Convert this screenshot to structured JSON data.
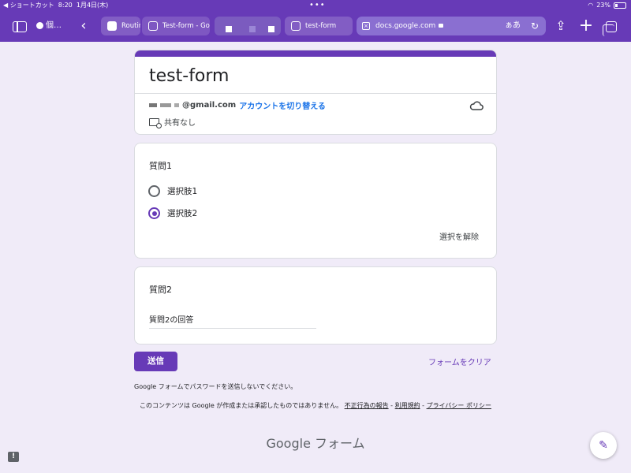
{
  "status_bar": {
    "shortcut": "◀ ショートカット",
    "time": "8:20",
    "date": "1月4日(木)",
    "battery": "23%"
  },
  "browser": {
    "profile_label": "個…",
    "tabs": [
      {
        "label": "Routine",
        "active": false
      },
      {
        "label": "Test-form - Go",
        "active": true
      },
      {
        "label": "test-form",
        "active": false
      }
    ],
    "address": "docs.google.com",
    "kana_label": "ぁあ"
  },
  "form": {
    "title": "test-form",
    "account_email": "@gmail.com",
    "switch_account_label": "アカウントを切り替える",
    "share_status": "共有なし",
    "questions": [
      {
        "title": "質問1",
        "options": [
          "選択肢1",
          "選択肢2"
        ],
        "selected": "選択肢2",
        "clear_label": "選択を解除"
      },
      {
        "title": "質問2",
        "answer": "質問2の回答"
      }
    ],
    "submit_label": "送信",
    "clear_form_label": "フォームをクリア"
  },
  "footer": {
    "password_warning": "Google フォームでパスワードを送信しないでください。",
    "disclaimer_prefix": "このコンテンツは Google が作成または承認したものではありません。",
    "report_abuse": "不正行為の報告",
    "sep1": " - ",
    "terms": "利用規約",
    "sep2": " - ",
    "privacy": "プライバシー ポリシー",
    "brand": "Google フォーム"
  },
  "colors": {
    "accent": "#673ab7",
    "background": "#f0ebf8",
    "link": "#1a73e8"
  }
}
